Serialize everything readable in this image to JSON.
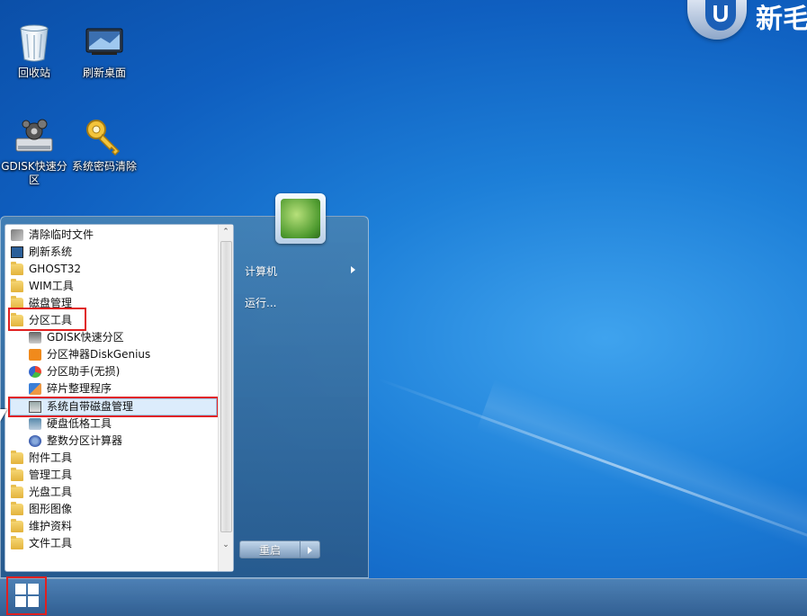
{
  "brand": {
    "letter": "U",
    "text": "新毛"
  },
  "desktop_icons": [
    {
      "label": "回收站",
      "icon": "recycle-bin-icon"
    },
    {
      "label": "刷新桌面",
      "icon": "monitor-icon"
    },
    {
      "label": "GDISK快速分区",
      "icon": "disk-gear-icon"
    },
    {
      "label": "系统密码清除",
      "icon": "key-icon"
    }
  ],
  "start_menu": {
    "programs": [
      {
        "label": "清除临时文件",
        "icon": "broom-icon"
      },
      {
        "label": "刷新系统",
        "icon": "monitor-icon"
      },
      {
        "label": "GHOST32",
        "icon": "folder-icon"
      },
      {
        "label": "WIM工具",
        "icon": "folder-icon"
      },
      {
        "label": "磁盘管理",
        "icon": "folder-icon"
      },
      {
        "label": "分区工具",
        "icon": "folder-icon"
      },
      {
        "label": "GDISK快速分区",
        "icon": "disk-gear-icon"
      },
      {
        "label": "分区神器DiskGenius",
        "icon": "diskgenius-icon"
      },
      {
        "label": "分区助手(无损)",
        "icon": "partition-assistant-icon"
      },
      {
        "label": "碎片整理程序",
        "icon": "defrag-icon"
      },
      {
        "label": "系统自带磁盘管理",
        "icon": "disk-management-icon"
      },
      {
        "label": "硬盘低格工具",
        "icon": "lowformat-icon"
      },
      {
        "label": "整数分区计算器",
        "icon": "calculator-icon"
      },
      {
        "label": "附件工具",
        "icon": "folder-icon"
      },
      {
        "label": "管理工具",
        "icon": "folder-icon"
      },
      {
        "label": "光盘工具",
        "icon": "folder-icon"
      },
      {
        "label": "图形图像",
        "icon": "folder-icon"
      },
      {
        "label": "维护资料",
        "icon": "folder-icon"
      },
      {
        "label": "文件工具",
        "icon": "folder-icon"
      }
    ],
    "right": {
      "computer": "计算机",
      "run": "运行..."
    },
    "restart_label": "重启"
  },
  "taskbar": {
    "start_icon": "windows-logo-icon"
  },
  "colors": {
    "highlight": "#e02020",
    "selection": "#dcecfc"
  }
}
